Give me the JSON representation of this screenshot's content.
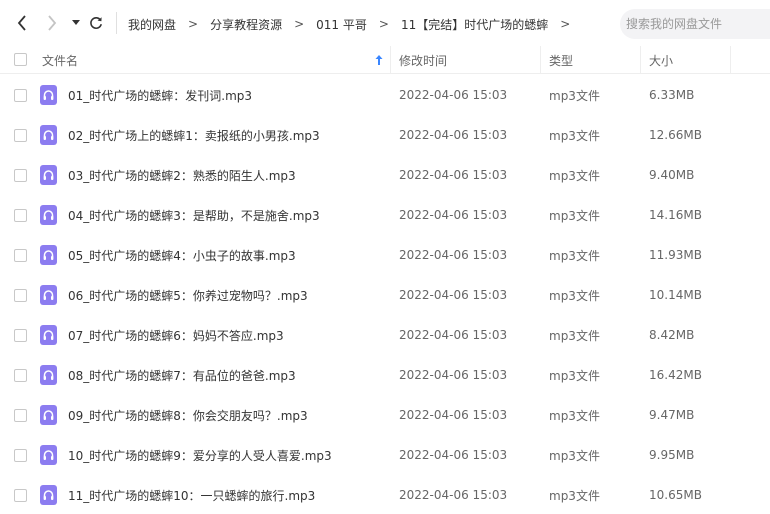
{
  "toolbar": {
    "back_icon": "chevron-left-icon",
    "forward_icon": "chevron-right-icon",
    "history_icon": "caret-down-icon",
    "refresh_icon": "refresh-icon"
  },
  "breadcrumb": [
    "我的网盘",
    "分享教程资源",
    "011 平哥",
    "11【完结】时代广场的蟋蟀"
  ],
  "breadcrumb_separator": ">",
  "search": {
    "placeholder": "搜索我的网盘文件"
  },
  "columns": {
    "name": "文件名",
    "modified": "修改时间",
    "type": "类型",
    "size": "大小"
  },
  "colors": {
    "icon_purple": "#8c7cf0",
    "accent_blue": "#3a86ff"
  },
  "files": [
    {
      "name": "01_时代广场的蟋蟀：发刊词.mp3",
      "modified": "2022-04-06 15:03",
      "type": "mp3文件",
      "size": "6.33MB"
    },
    {
      "name": "02_时代广场上的蟋蟀1：卖报纸的小男孩.mp3",
      "modified": "2022-04-06 15:03",
      "type": "mp3文件",
      "size": "12.66MB"
    },
    {
      "name": "03_时代广场的蟋蟀2：熟悉的陌生人.mp3",
      "modified": "2022-04-06 15:03",
      "type": "mp3文件",
      "size": "9.40MB"
    },
    {
      "name": "04_时代广场的蟋蟀3：是帮助，不是施舍.mp3",
      "modified": "2022-04-06 15:03",
      "type": "mp3文件",
      "size": "14.16MB"
    },
    {
      "name": "05_时代广场的蟋蟀4：小虫子的故事.mp3",
      "modified": "2022-04-06 15:03",
      "type": "mp3文件",
      "size": "11.93MB"
    },
    {
      "name": "06_时代广场的蟋蟀5：你养过宠物吗？.mp3",
      "modified": "2022-04-06 15:03",
      "type": "mp3文件",
      "size": "10.14MB"
    },
    {
      "name": "07_时代广场的蟋蟀6：妈妈不答应.mp3",
      "modified": "2022-04-06 15:03",
      "type": "mp3文件",
      "size": "8.42MB"
    },
    {
      "name": "08_时代广场的蟋蟀7：有品位的爸爸.mp3",
      "modified": "2022-04-06 15:03",
      "type": "mp3文件",
      "size": "16.42MB"
    },
    {
      "name": "09_时代广场的蟋蟀8：你会交朋友吗？.mp3",
      "modified": "2022-04-06 15:03",
      "type": "mp3文件",
      "size": "9.47MB"
    },
    {
      "name": "10_时代广场的蟋蟀9：爱分享的人受人喜爱.mp3",
      "modified": "2022-04-06 15:03",
      "type": "mp3文件",
      "size": "9.95MB"
    },
    {
      "name": "11_时代广场的蟋蟀10：一只蟋蟀的旅行.mp3",
      "modified": "2022-04-06 15:03",
      "type": "mp3文件",
      "size": "10.65MB"
    }
  ]
}
